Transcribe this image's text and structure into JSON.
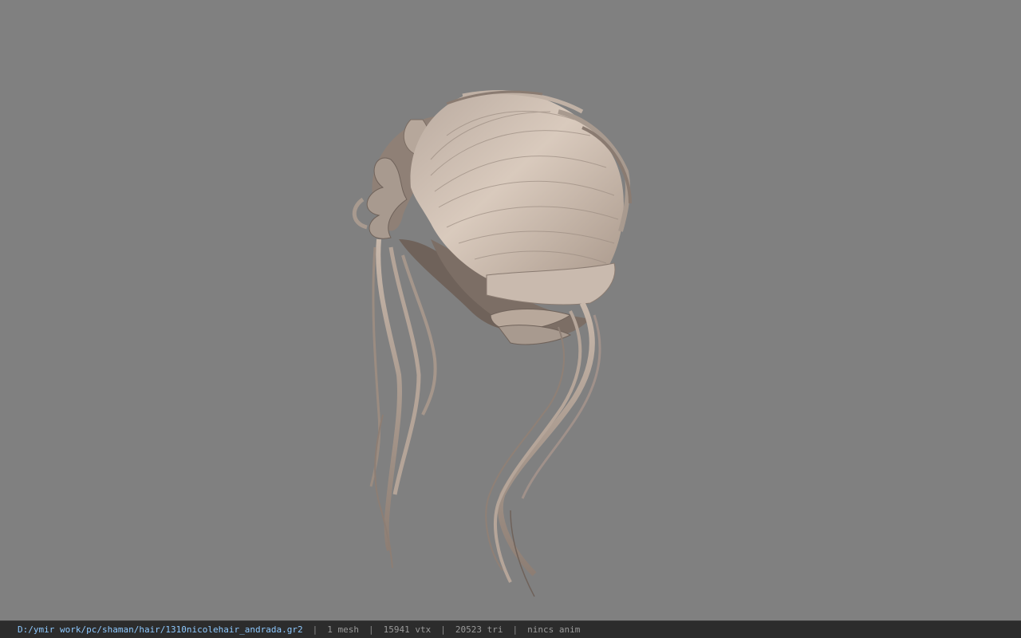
{
  "viewer": {
    "background_color": "#808080",
    "model_icon": "hair-mesh-model"
  },
  "status_bar": {
    "file_path": "D:/ymir work/pc/shaman/hair/1310nicolehair_andrada.gr2",
    "separator": "|",
    "mesh_count": "1 mesh",
    "vertex_count": "15941 vtx",
    "triangle_count": "20523 tri",
    "anim_status": "nincs anim",
    "path_color": "#8ec9ff",
    "text_color": "#9a9a9a",
    "bar_color": "#2c2c2c"
  }
}
